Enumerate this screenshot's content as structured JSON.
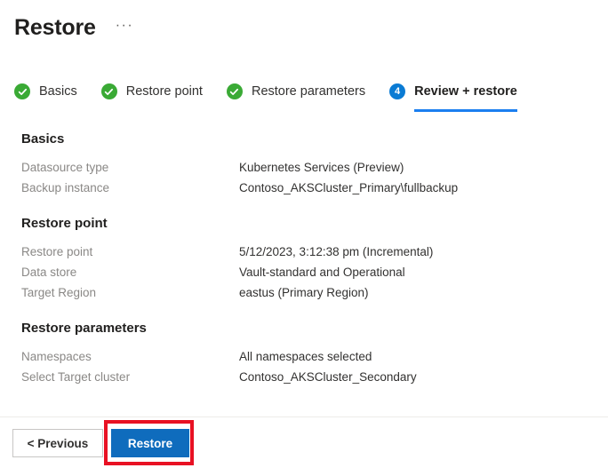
{
  "header": {
    "title": "Restore",
    "ellipsis": "···"
  },
  "wizard": {
    "tabs": [
      {
        "label": "Basics",
        "state": "done",
        "badge": "✓"
      },
      {
        "label": "Restore point",
        "state": "done",
        "badge": "✓"
      },
      {
        "label": "Restore parameters",
        "state": "done",
        "badge": "✓"
      },
      {
        "label": "Review + restore",
        "state": "current",
        "badge": "4"
      }
    ]
  },
  "sections": [
    {
      "title": "Basics",
      "rows": [
        {
          "label": "Datasource type",
          "value": "Kubernetes Services (Preview)"
        },
        {
          "label": "Backup instance",
          "value": "Contoso_AKSCluster_Primary\\fullbackup"
        }
      ]
    },
    {
      "title": "Restore point",
      "rows": [
        {
          "label": "Restore point",
          "value": "5/12/2023, 3:12:38 pm (Incremental)"
        },
        {
          "label": "Data store",
          "value": "Vault-standard and Operational"
        },
        {
          "label": "Target Region",
          "value": "eastus (Primary Region)"
        }
      ]
    },
    {
      "title": "Restore parameters",
      "rows": [
        {
          "label": "Namespaces",
          "value": "All namespaces selected"
        },
        {
          "label": "Select Target cluster",
          "value": "Contoso_AKSCluster_Secondary"
        }
      ]
    }
  ],
  "footer": {
    "previous_label": "< Previous",
    "restore_label": "Restore"
  },
  "colors": {
    "accent_blue": "#0f6cbd",
    "tab_underline_blue": "#1b7ff0",
    "badge_blue": "#0a7bd4",
    "success_green": "#3AAA35",
    "highlight_red": "#e81123",
    "label_gray": "#8a8886"
  }
}
